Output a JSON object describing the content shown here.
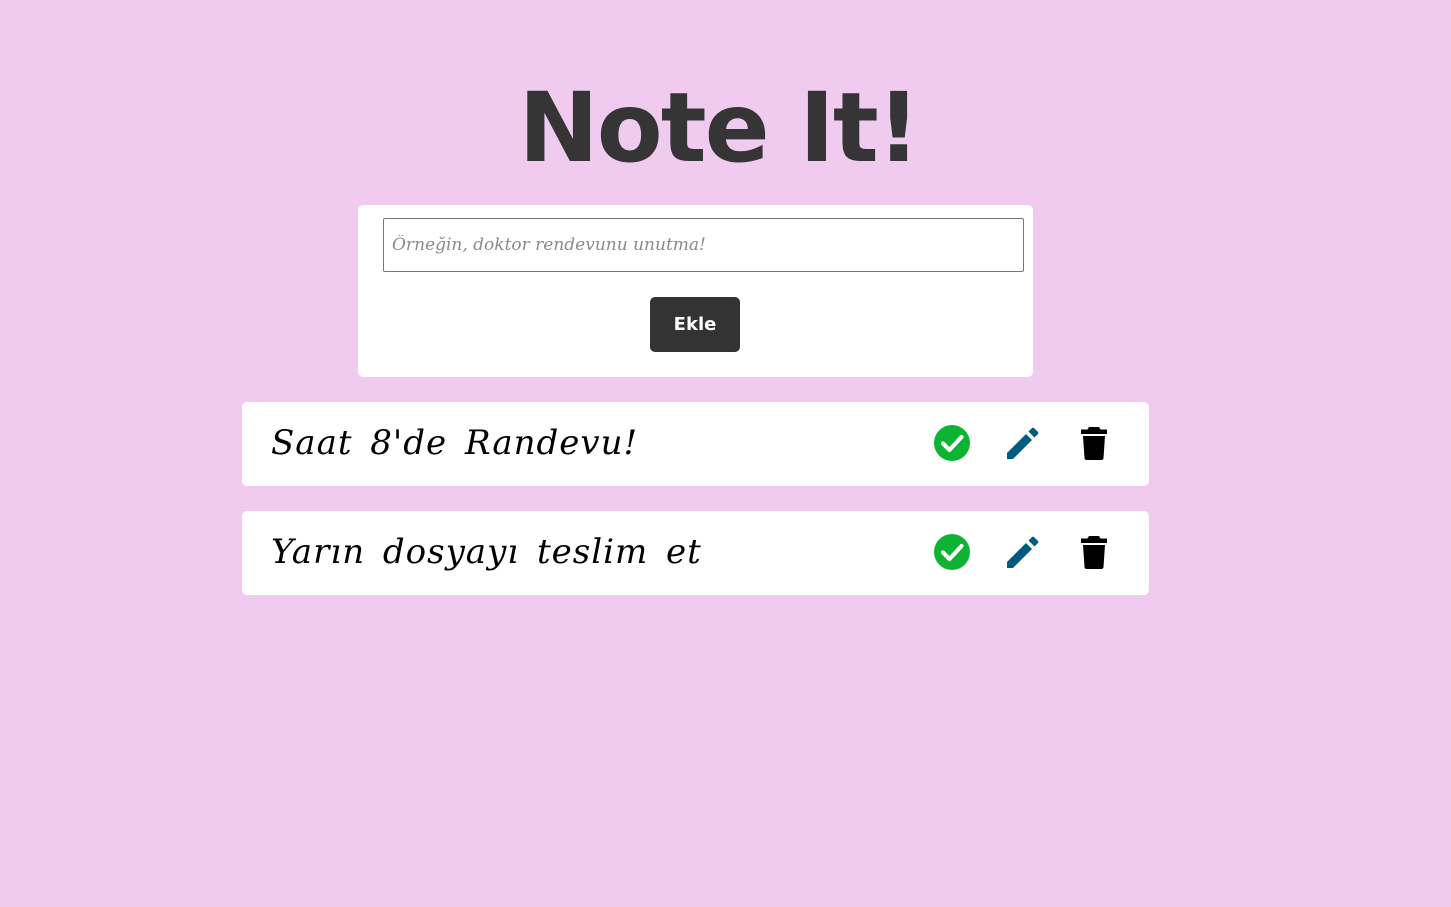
{
  "app": {
    "title": "Note It!"
  },
  "form": {
    "input_value": "",
    "input_placeholder": "Örneğin, doktor rendevunu unutma!",
    "add_label": "Ekle"
  },
  "notes": [
    {
      "text": "Saat 8'de Randevu!",
      "actions": [
        "check-circle-icon",
        "pencil-icon",
        "trash-icon"
      ]
    },
    {
      "text": "Yarın dosyayı teslim et",
      "actions": [
        "check-circle-icon",
        "pencil-icon",
        "trash-icon"
      ]
    }
  ],
  "colors": {
    "background": "#f1cbef",
    "title": "#353535",
    "button": "#333333",
    "done_icon": "#0db332",
    "edit_icon": "#005c7e",
    "delete_icon": "#000000"
  }
}
